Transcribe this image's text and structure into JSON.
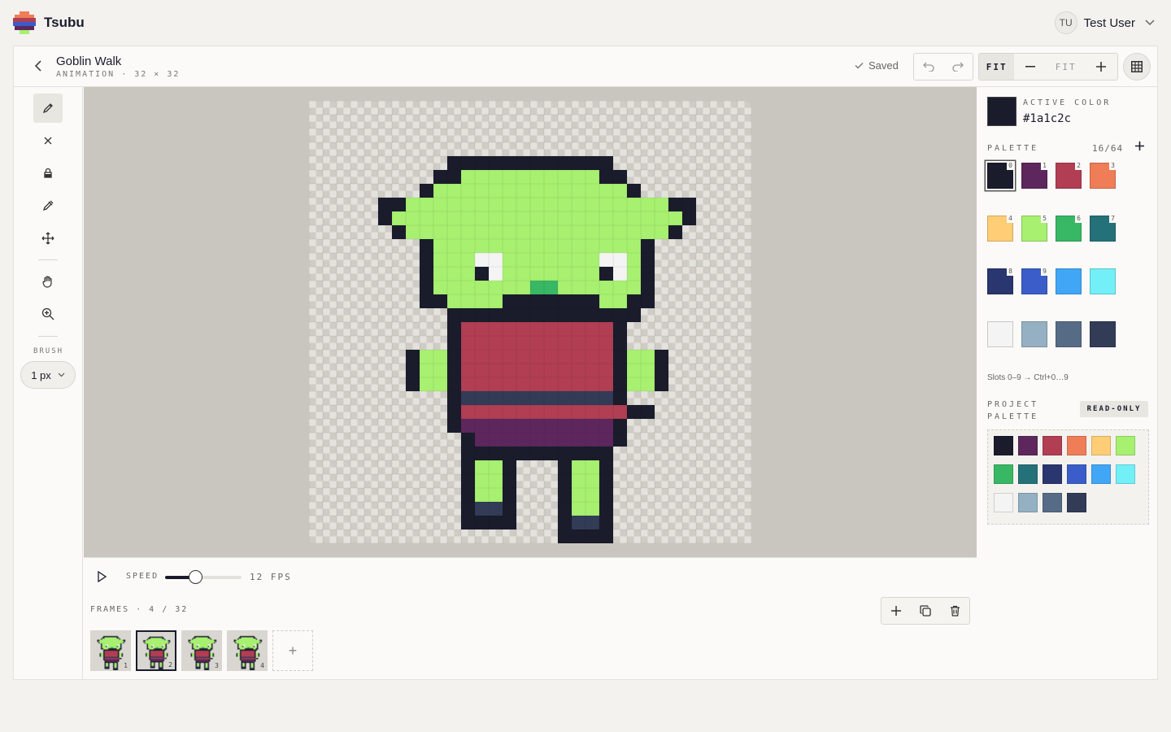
{
  "brand": {
    "name": "Tsubu"
  },
  "user": {
    "initials": "TU",
    "name": "Test User"
  },
  "document": {
    "title": "Goblin Walk",
    "subtitle": "ANIMATION · 32 × 32"
  },
  "header": {
    "saved_label": "Saved",
    "zoom_fit_label": "FIT",
    "zoom_value": "FIT"
  },
  "brush": {
    "label": "BRUSH",
    "size": "1 px"
  },
  "timeline": {
    "speed_label": "SPEED",
    "fps_label": "12 FPS",
    "fps": 12,
    "speed_level": 0.39,
    "frames_label": "FRAMES · 4 / 32",
    "frames": [
      {
        "num": "1"
      },
      {
        "num": "2",
        "active": true
      },
      {
        "num": "3"
      },
      {
        "num": "4"
      }
    ]
  },
  "panel": {
    "active_label": "ACTIVE COLOR",
    "active_hex": "#1a1c2c",
    "palette_label": "PALETTE",
    "palette_count": "16/64",
    "palette": [
      "#1a1c2c",
      "#5d275d",
      "#b13e53",
      "#ef7d57",
      "#ffcd75",
      "#a7f070",
      "#38b764",
      "#257179",
      "#29366f",
      "#3b5dc9",
      "#41a6f6",
      "#73eff7",
      "#f4f4f4",
      "#94b0c2",
      "#566c86",
      "#333c57"
    ],
    "slot_labels": [
      "0",
      "1",
      "2",
      "3",
      "4",
      "5",
      "6",
      "7",
      "8",
      "9"
    ],
    "slots_hint": "Slots 0–9 → Ctrl+0…9",
    "project_label": "PROJECT PALETTE",
    "readonly_label": "READ-ONLY"
  },
  "sprite": {
    "rows": [
      "................................",
      "................................",
      "................................",
      "................................",
      "..........000000000000..........",
      ".........00555555555500.........",
      "........0555555555555550........",
      ".....00555555555555555555500....",
      ".....05555555555555555555550....",
      "......055555555555555555550.....",
      "........05555555555555550.......",
      "........0555CC5555555CC50.......",
      "........05550C55555550C50.......",
      "........05555555665555550.......",
      "........00555500000005500.......",
      "..........00000000000000........",
      "..........0222222222220.........",
      "..........0222222222220.........",
      ".......0550222222222220550......",
      ".......0550222222222220550......",
      ".......0550222222222220550......",
      "..........0FFFFFFFFFFF0.........",
      "..........022222222222200.......",
      "..........0111111111110.........",
      "...........011111111110.........",
      "...........00000000000..........",
      "...........0550...0550..........",
      "...........0550...0550..........",
      "...........0550...0550..........",
      "...........0FF0...0550..........",
      "...........0000...0FF0..........",
      "..................0000.........."
    ]
  }
}
